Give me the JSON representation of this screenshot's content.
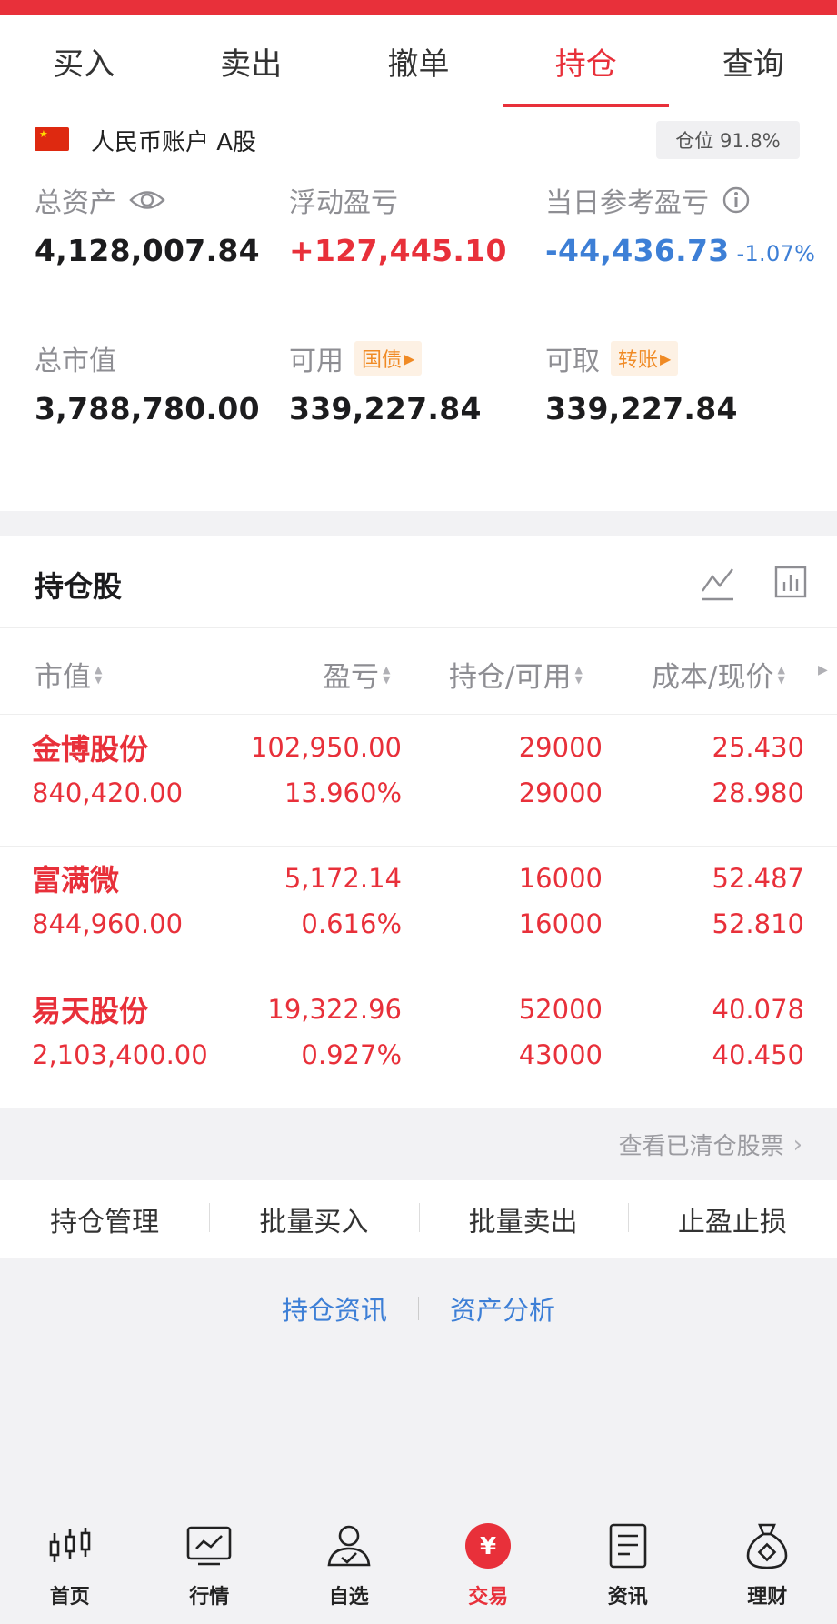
{
  "colors": {
    "accent": "#e8303a",
    "loss_blue": "#3d7fd6",
    "tag_orange": "#f08a24"
  },
  "tabs": [
    {
      "label": "买入",
      "active": false
    },
    {
      "label": "卖出",
      "active": false
    },
    {
      "label": "撤单",
      "active": false
    },
    {
      "label": "持仓",
      "active": true
    },
    {
      "label": "查询",
      "active": false
    }
  ],
  "account": {
    "flag_icon": "china-flag-icon",
    "name": "人民币账户 A股",
    "position": "仓位 91.8%"
  },
  "summary": {
    "total_assets": {
      "label": "总资产",
      "value": "4,128,007.84",
      "icon": "eye-icon"
    },
    "floating_pnl": {
      "label": "浮动盈亏",
      "value": "+127,445.10"
    },
    "day_pnl": {
      "label": "当日参考盈亏",
      "value": "-44,436.73",
      "pct": "-1.07%",
      "icon": "info-icon"
    },
    "market_value": {
      "label": "总市值",
      "value": "3,788,780.00"
    },
    "available": {
      "label": "可用",
      "tag": "国债",
      "value": "339,227.84"
    },
    "withdrawable": {
      "label": "可取",
      "tag": "转账",
      "value": "339,227.84"
    }
  },
  "holdings": {
    "title": "持仓股",
    "columns": [
      "市值",
      "盈亏",
      "持仓/可用",
      "成本/现价"
    ],
    "rows": [
      {
        "name": "金博股份",
        "market_value": "840,420.00",
        "pnl": "102,950.00",
        "pnl_pct": "13.960%",
        "hold": "29000",
        "avail": "29000",
        "cost": "25.430",
        "price": "28.980"
      },
      {
        "name": "富满微",
        "market_value": "844,960.00",
        "pnl": "5,172.14",
        "pnl_pct": "0.616%",
        "hold": "16000",
        "avail": "16000",
        "cost": "52.487",
        "price": "52.810"
      },
      {
        "name": "易天股份",
        "market_value": "2,103,400.00",
        "pnl": "19,322.96",
        "pnl_pct": "0.927%",
        "hold": "52000",
        "avail": "43000",
        "cost": "40.078",
        "price": "40.450"
      }
    ]
  },
  "cleared_link": "查看已清仓股票",
  "actions": [
    "持仓管理",
    "批量买入",
    "批量卖出",
    "止盈止损"
  ],
  "links": [
    "持仓资讯",
    "资产分析"
  ],
  "bottom_nav": [
    {
      "label": "首页",
      "icon": "candlestick-icon",
      "active": false
    },
    {
      "label": "行情",
      "icon": "chart-monitor-icon",
      "active": false
    },
    {
      "label": "自选",
      "icon": "user-check-icon",
      "active": false
    },
    {
      "label": "交易",
      "icon": "yuan-circle-icon",
      "active": true
    },
    {
      "label": "资讯",
      "icon": "document-icon",
      "active": false
    },
    {
      "label": "理财",
      "icon": "money-bag-icon",
      "active": false
    }
  ]
}
